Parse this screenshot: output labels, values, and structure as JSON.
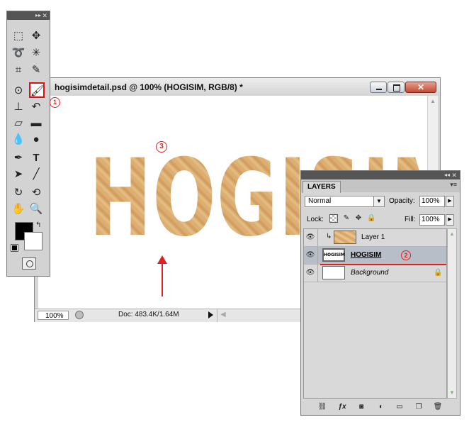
{
  "document": {
    "title": "hogisimdetail.psd @ 100% (HOGISIM, RGB/8) *",
    "close_glyph": "✕",
    "canvas_text": "HOGISIM",
    "status": {
      "zoom": "100%",
      "doc_info": "Doc: 483.4K/1.64M"
    }
  },
  "annotations": {
    "marker1": "1",
    "marker2": "2",
    "marker3": "3",
    "color": "#e02020"
  },
  "tools_panel": {
    "collapse": "▸▸",
    "close": "✕",
    "icons": [
      "marquee-icon",
      "move-icon",
      "lasso-icon",
      "magic-wand-icon",
      "crop-icon",
      "eyedropper-icon",
      "spot-healing-icon",
      "brush-icon",
      "clone-stamp-icon",
      "history-brush-icon",
      "eraser-icon",
      "gradient-icon",
      "blur-icon",
      "dodge-icon",
      "pen-icon",
      "type-icon",
      "path-selection-icon",
      "line-icon",
      "rotate-view-icon",
      "3d-rotate-icon",
      "hand-icon",
      "zoom-icon"
    ],
    "type_tool_glyph": "T"
  },
  "layers_panel": {
    "collapse": "◂◂",
    "close": "✕",
    "tab_label": "LAYERS",
    "menu_glyph": "▾≡",
    "blend_mode": "Normal",
    "opacity_label": "Opacity:",
    "opacity_value": "100%",
    "lock_label": "Lock:",
    "fill_label": "Fill:",
    "fill_value": "100%",
    "layers": [
      {
        "name": "Layer 1",
        "visible": true,
        "clipped": true
      },
      {
        "name": "HOGISIM",
        "visible": true,
        "selected": true,
        "thumb_text": "HOGISIM"
      },
      {
        "name": "Background",
        "visible": true,
        "locked": true
      }
    ],
    "footer_icons": [
      "link-icon",
      "fx-icon",
      "mask-icon",
      "adjustment-icon",
      "group-icon",
      "new-layer-icon",
      "trash-icon"
    ]
  }
}
